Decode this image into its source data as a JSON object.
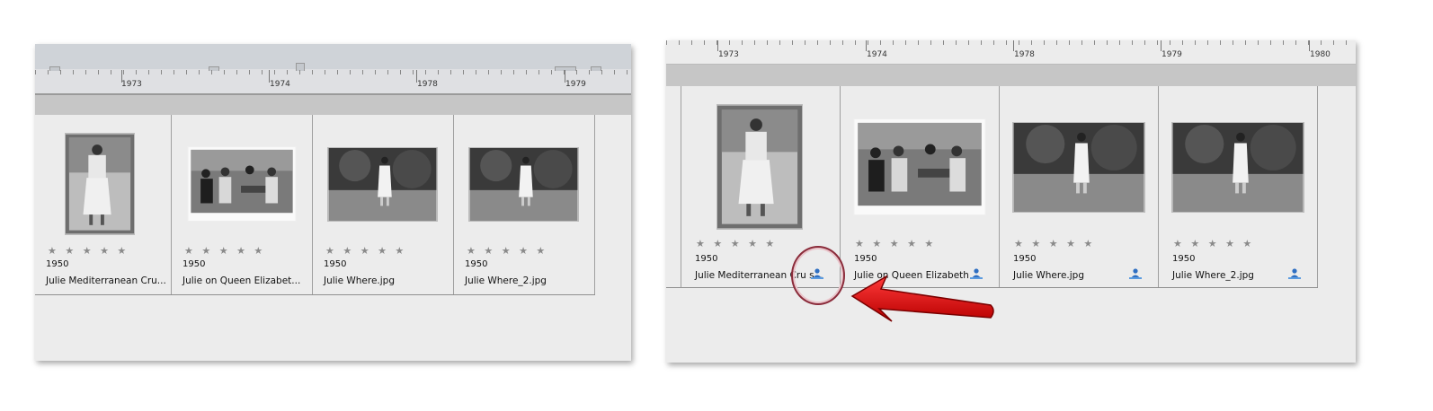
{
  "left_panel": {
    "timeline_years": [
      "1973",
      "1974",
      "1978",
      "1979"
    ],
    "items": [
      {
        "rating": "★ ★ ★ ★ ★",
        "year": "1950",
        "filename": "Julie Mediterranean Cru..."
      },
      {
        "rating": "★ ★ ★ ★ ★",
        "year": "1950",
        "filename": "Julie on Queen Elizabet..."
      },
      {
        "rating": "★ ★ ★ ★ ★",
        "year": "1950",
        "filename": "Julie Where.jpg"
      },
      {
        "rating": "★ ★ ★ ★ ★",
        "year": "1950",
        "filename": "Julie Where_2.jpg"
      }
    ]
  },
  "right_panel": {
    "timeline_years": [
      "1973",
      "1974",
      "1978",
      "1979",
      "1980"
    ],
    "items": [
      {
        "rating": "★ ★ ★ ★ ★",
        "year": "1950",
        "filename": "Julie Mediterranean Cru s...",
        "icon": "person-tag-icon"
      },
      {
        "rating": "★ ★ ★ ★ ★",
        "year": "1950",
        "filename": "Julie on Queen Elizabeth ...",
        "icon": "person-tag-icon"
      },
      {
        "rating": "★ ★ ★ ★ ★",
        "year": "1950",
        "filename": "Julie Where.jpg",
        "icon": "person-tag-icon"
      },
      {
        "rating": "★ ★ ★ ★ ★",
        "year": "1950",
        "filename": "Julie Where_2.jpg",
        "icon": "person-tag-icon"
      }
    ]
  },
  "annotation": {
    "circle_color": "#8b2b3a",
    "arrow_color": "#d40000"
  }
}
